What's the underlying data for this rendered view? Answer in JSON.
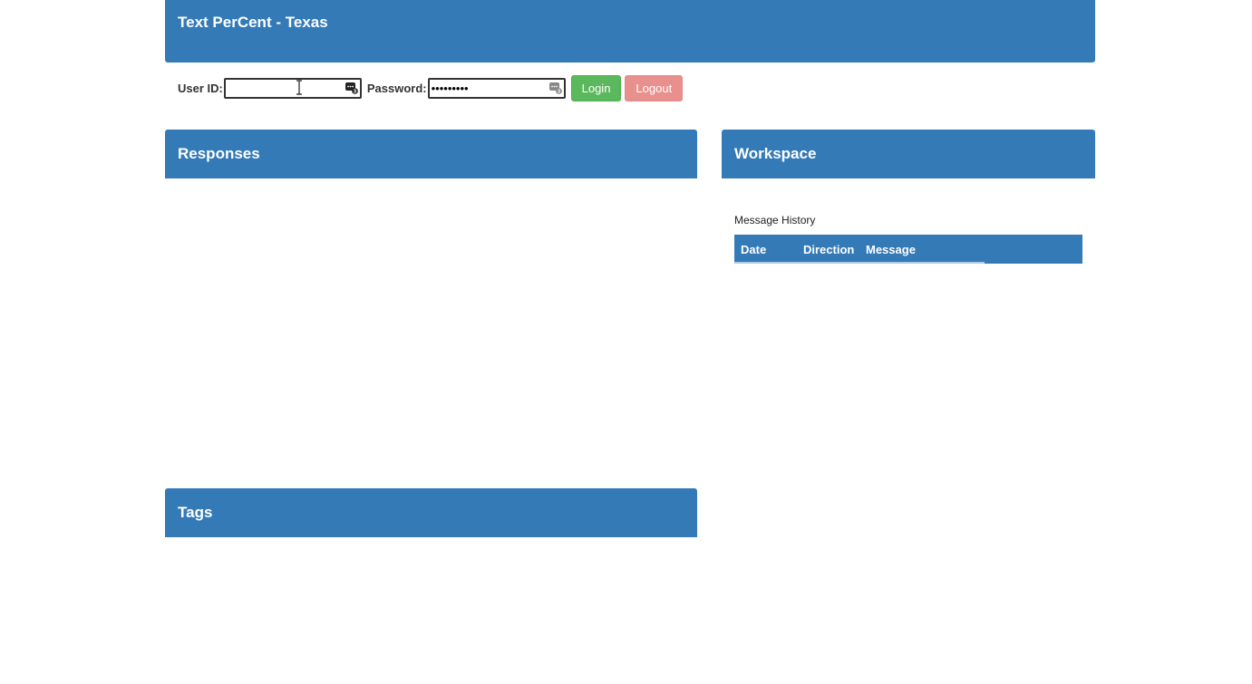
{
  "header": {
    "title": "Text PerCent - Texas"
  },
  "login": {
    "user_id_label": "User ID:",
    "user_id_value": "",
    "password_label": "Password:",
    "password_value": "•••••••••",
    "login_button": "Login",
    "logout_button": "Logout"
  },
  "panels": {
    "responses_title": "Responses",
    "workspace_title": "Workspace",
    "tags_title": "Tags"
  },
  "message_history": {
    "label": "Message History",
    "columns": [
      "Date",
      "Direction",
      "Message"
    ]
  },
  "colors": {
    "header_blue": "#337ab7",
    "login_green": "#5cb85c",
    "logout_red": "#e8908d"
  },
  "icons": {
    "password_manager": "key-badge-icon",
    "text_cursor": "text-cursor-icon"
  }
}
